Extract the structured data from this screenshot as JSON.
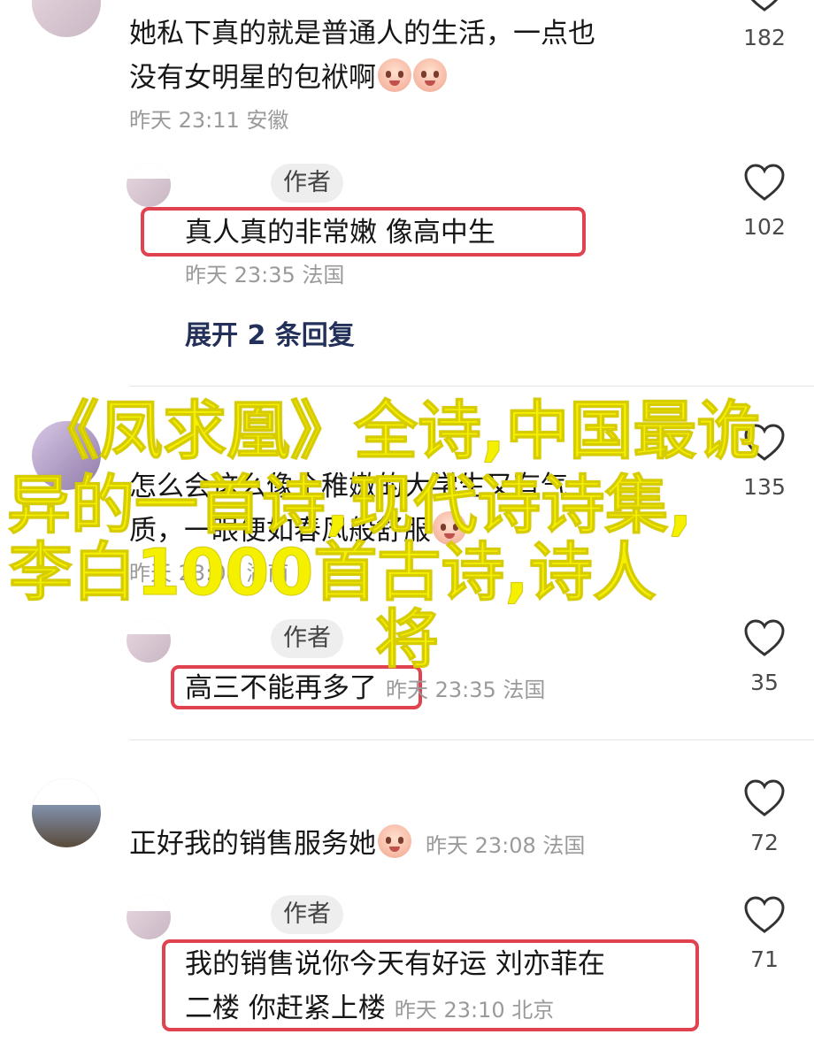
{
  "comments": [
    {
      "text_line1": "她私下真的就是普通人的生活，一点也",
      "text_line2": "没有女明星的包袱啊",
      "meta": "昨天 23:11 安徽",
      "likes": "182",
      "reply": {
        "badge": "作者",
        "text": "真人真的非常嫩 像高中生",
        "meta": "昨天 23:35 法国",
        "likes": "102"
      },
      "expand": "展开 2 条回复"
    },
    {
      "text_line1": "怎么会这么像个稚嫩的大学生又有气",
      "text_line2": "质，一眼便如春风般舒服",
      "meta": "昨天 23:08 湖南",
      "likes": "135",
      "reply": {
        "badge": "作者",
        "text": "高三不能再多了",
        "meta": "昨天 23:35 法国",
        "likes": "35"
      }
    },
    {
      "text": "正好我的销售服务她",
      "meta": "昨天 23:08 法国",
      "likes": "72",
      "reply": {
        "badge": "作者",
        "text_line1": "我的销售说你今天有好运 刘亦菲在",
        "text_line2": "二楼 你赶紧上楼",
        "meta": "昨天 23:10 北京",
        "likes": "71"
      }
    }
  ],
  "watermark": {
    "line1": "《凤求凰》全诗,中国最诡",
    "line2": "异的一首诗,现代诗诗集,",
    "line3": "李白1000首古诗,诗人",
    "line4": "将"
  },
  "colors": {
    "highlight_box": "#e04250",
    "watermark": "#f4f000",
    "expand_link": "#22305a"
  }
}
